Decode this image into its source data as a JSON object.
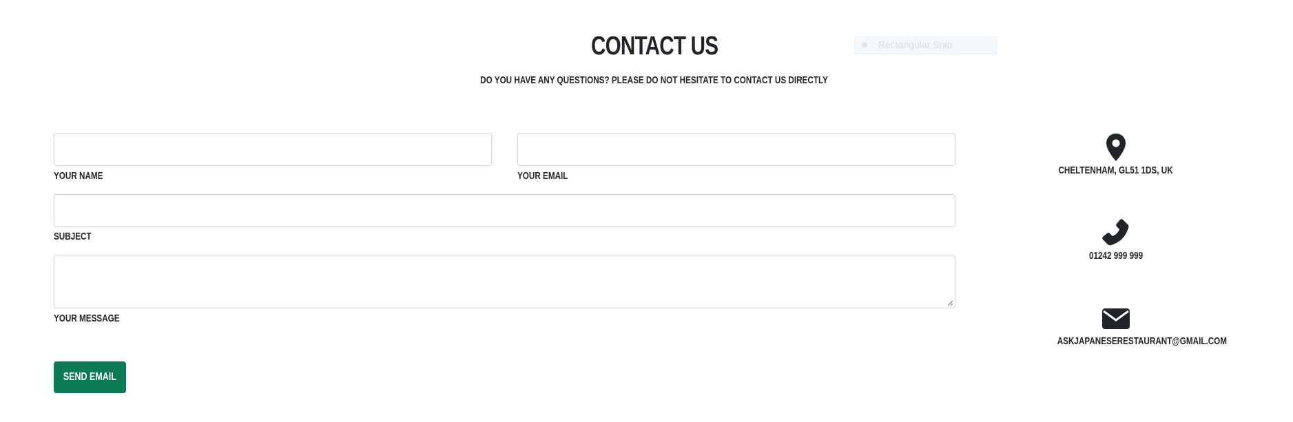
{
  "header": {
    "title": "CONTACT US",
    "subtitle": "DO YOU HAVE ANY QUESTIONS? PLEASE DO NOT HESITATE TO CONTACT US DIRECTLY"
  },
  "overlay": {
    "snip_label": "Rectangular Snip"
  },
  "form": {
    "name": {
      "label": "YOUR NAME",
      "value": ""
    },
    "email": {
      "label": "YOUR EMAIL",
      "value": ""
    },
    "subject": {
      "label": "SUBJECT",
      "value": ""
    },
    "message": {
      "label": "YOUR MESSAGE",
      "value": ""
    },
    "submit_label": "SEND EMAIL"
  },
  "contact_info": {
    "address": {
      "icon": "map-marker-icon",
      "text": "CHELTENHAM, GL51 1DS, UK"
    },
    "phone": {
      "icon": "phone-icon",
      "text": "01242 999 999"
    },
    "email": {
      "icon": "envelope-icon",
      "text": "ASKJAPANESERESTAURANT@GMAIL.COM"
    }
  },
  "colors": {
    "button": "#0b7a55",
    "text": "#212529",
    "border": "#ced4da"
  }
}
